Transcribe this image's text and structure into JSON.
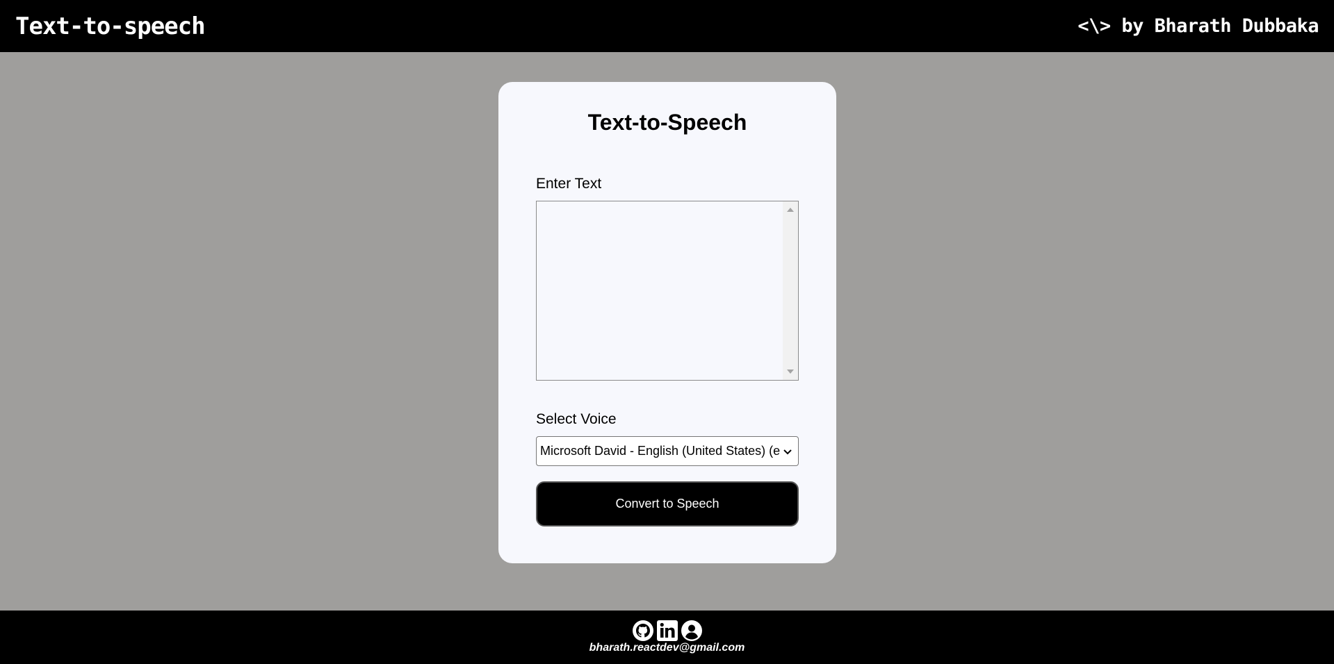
{
  "header": {
    "title": "Text-to-speech",
    "author": "<\\> by Bharath Dubbaka"
  },
  "card": {
    "title": "Text-to-Speech",
    "text_label": "Enter Text",
    "text_value": "",
    "voice_label": "Select Voice",
    "voice_selected": "Microsoft David - English (United States) (en-US)",
    "convert_label": "Convert to Speech"
  },
  "footer": {
    "icons": [
      "github-icon",
      "linkedin-icon",
      "profile-icon"
    ],
    "email": "bharath.reactdev@gmail.com"
  },
  "colors": {
    "page_bg": "#9f9e9c",
    "bar_bg": "#000000",
    "card_bg": "#f7f8fd",
    "button_bg": "#000000"
  }
}
